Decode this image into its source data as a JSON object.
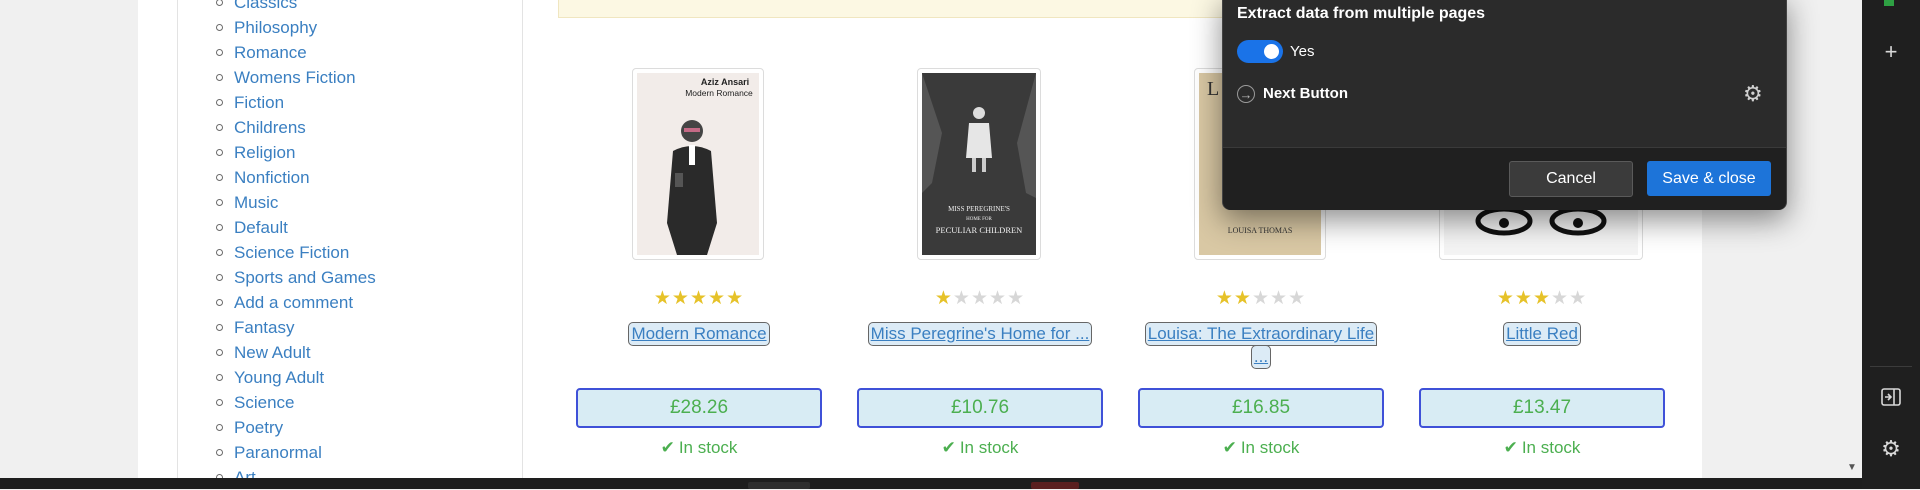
{
  "sidebar": {
    "categories": [
      "Classics",
      "Philosophy",
      "Romance",
      "Womens Fiction",
      "Fiction",
      "Childrens",
      "Religion",
      "Nonfiction",
      "Music",
      "Default",
      "Science Fiction",
      "Sports and Games",
      "Add a comment",
      "Fantasy",
      "New Adult",
      "Young Adult",
      "Science",
      "Poetry",
      "Paranormal",
      "Art"
    ]
  },
  "products": [
    {
      "title": "Modern Romance",
      "price": "£28.26",
      "stock": "In stock",
      "rating": 5,
      "cover_text": {
        "author": "Aziz Ansari",
        "title": "Modern Romance"
      }
    },
    {
      "title": "Miss Peregrine's Home for ...",
      "price": "£10.76",
      "stock": "In stock",
      "rating": 1,
      "cover_text": {
        "line1": "MISS PEREGRINE'S",
        "line2": "HOME FOR",
        "line3": "PECULIAR CHILDREN"
      }
    },
    {
      "title": "Louisa: The Extraordinary Life ...",
      "title_line1": "Louisa: The Extraordinary Life",
      "title_line2": "...",
      "price": "£16.85",
      "stock": "In stock",
      "rating": 2,
      "cover_text": {
        "author": "LOUISA THOMAS"
      }
    },
    {
      "title": "Little Red",
      "price": "£13.47",
      "stock": "In stock",
      "rating": 3
    }
  ],
  "dialog": {
    "heading": "Extract data from multiple pages",
    "toggle_label": "Yes",
    "toggle_on": true,
    "next_button_label": "Next Button",
    "cancel_label": "Cancel",
    "save_label": "Save & close"
  },
  "icons": {
    "plus": "plus-icon",
    "sidebar_panel": "panel-icon",
    "settings": "gear-icon",
    "next": "arrow-circle-icon",
    "check": "check-icon",
    "star": "star-icon"
  },
  "colors": {
    "link": "#3a7fc1",
    "price_text": "#4caf50",
    "star_on": "#e6c229",
    "accent": "#1d74d9"
  }
}
